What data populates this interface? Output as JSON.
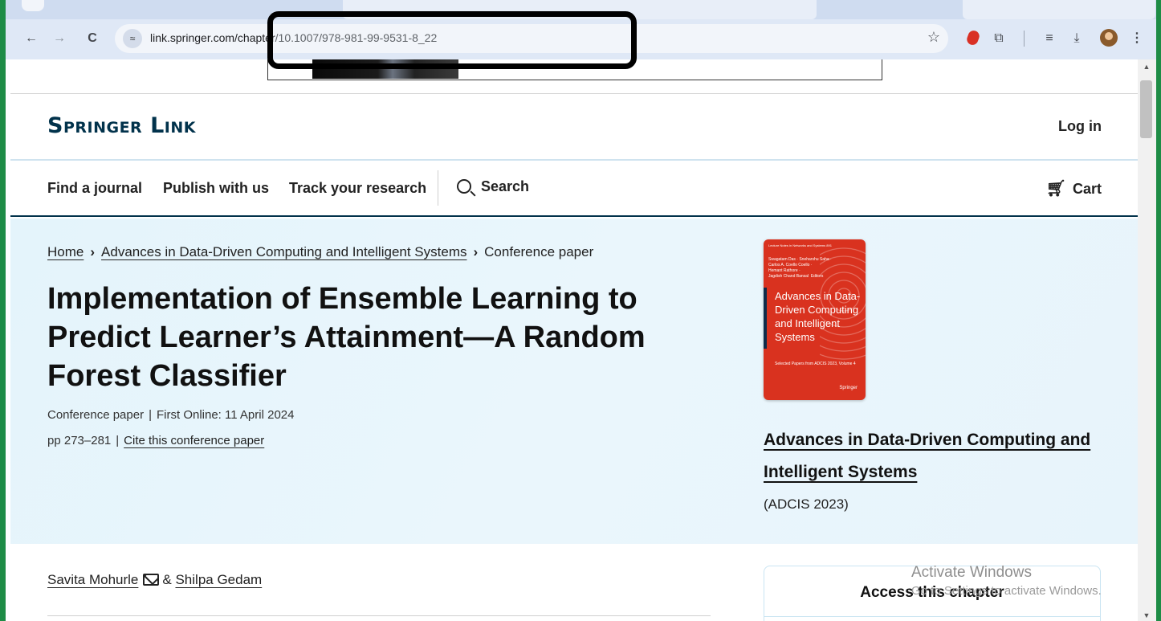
{
  "browser": {
    "url_host": "link.springer.com/chapter",
    "url_path": "/10.1007/978-981-99-9531-8_22"
  },
  "site": {
    "logo": "Springer Link",
    "login_label": "Log in",
    "nav": {
      "find_journal": "Find a journal",
      "publish": "Publish with us",
      "track": "Track your research",
      "search": "Search",
      "cart": "Cart"
    }
  },
  "breadcrumb": {
    "home": "Home",
    "book": "Advances in Data-Driven Computing and Intelligent Systems",
    "current": "Conference paper"
  },
  "article": {
    "title": "Implementation of Ensemble Learning to Predict Learner’s Attainment—A Random Forest Classifier",
    "type": "Conference paper",
    "first_online": "First Online: 11 April 2024",
    "pages": "pp 273–281",
    "cite_label": "Cite this conference paper",
    "authors": [
      {
        "name": "Savita Mohurle"
      },
      {
        "name": "Shilpa Gedam"
      }
    ],
    "author_joiner": "&"
  },
  "book": {
    "cover": {
      "series": "Lecture Notes in Networks and Systems 891",
      "editors": "Swagatam Das · Sneharshu Saha ·\nCarlos A. Coello Coello ·\nHemant Rathore ·\nJagdish Chand Bansal  Editors",
      "title": "Advances in Data-Driven Computing and Intelligent Systems",
      "subtitle": "Selected Papers from ADCIS 2023, Volume 4",
      "publisher": "Springer"
    },
    "title": "Advances in Data-Driven Computing and Intelligent Systems",
    "conference": "(ADCIS 2023)"
  },
  "access": {
    "title": "Access this chapter"
  },
  "overlay": {
    "watermark_line1": "Activate Windows",
    "watermark_line2": "Go to Settings to activate Windows."
  }
}
